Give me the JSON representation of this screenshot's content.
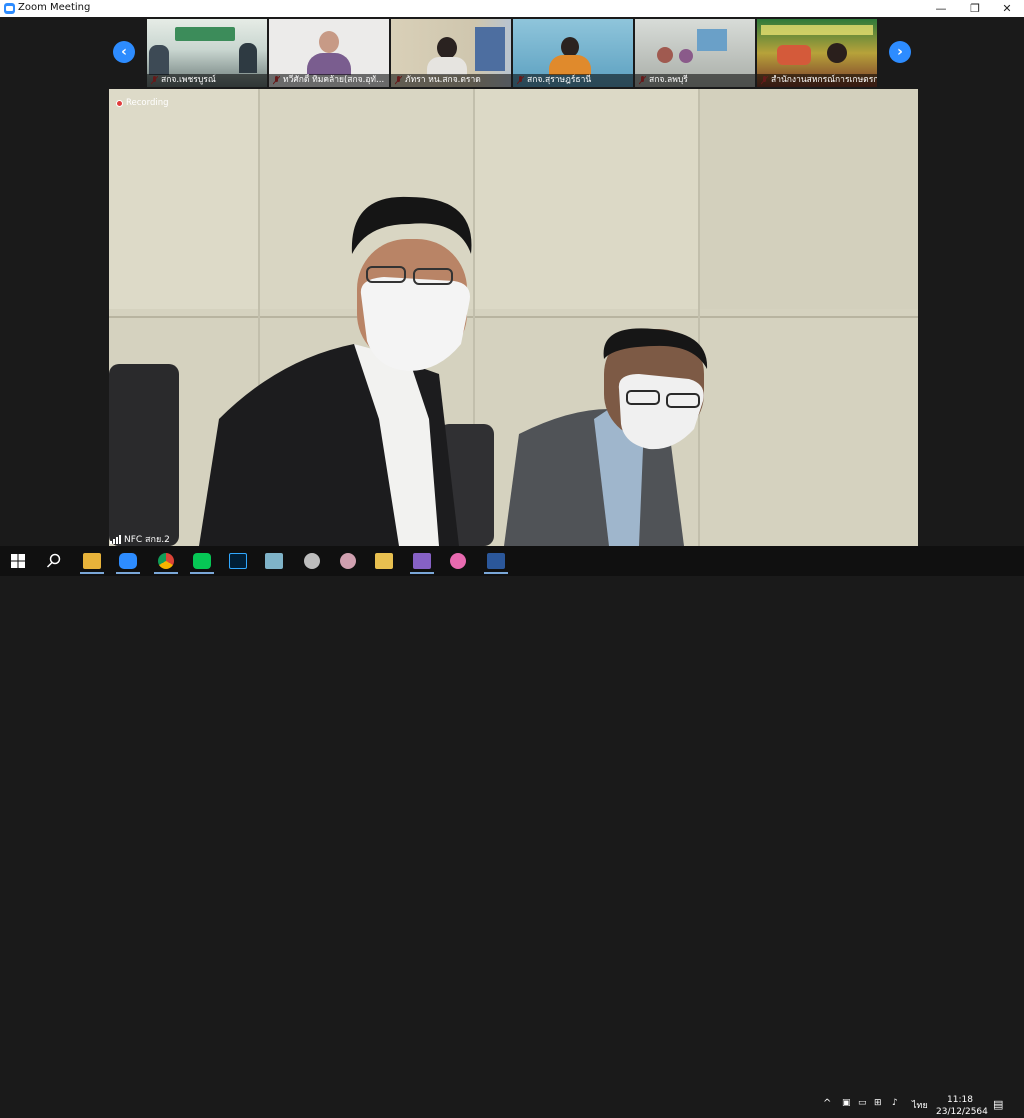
{
  "window": {
    "title": "Zoom Meeting",
    "minimize": "—",
    "maximize": "❐",
    "close": "✕"
  },
  "gallery": {
    "prev": "‹",
    "next": "›",
    "thumbnails": [
      {
        "name": "สกจ.เพชรบูรณ์",
        "bg": "#8fa7a0"
      },
      {
        "name": "ทวีศักดิ์ ทิมคล้าย(สกจ.อุทั...",
        "bg": "#e8e8e6"
      },
      {
        "name": "ภัทรา หน.สกจ.ตราด",
        "bg": "#cfc9b8"
      },
      {
        "name": "สกจ.สุราษฎร์ธานี",
        "bg": "#6fb0c9"
      },
      {
        "name": "สกจ.ลพบุรี",
        "bg": "#b9bcb6"
      },
      {
        "name": "สำนักงานสหกรณ์การเกษตรกร จั...",
        "bg": "#8c9a3c"
      }
    ]
  },
  "main_video": {
    "recording": "Recording",
    "participant": "NFC สกย.2"
  },
  "taskbar": {
    "apps": [
      {
        "name": "start",
        "color": "#ffffff"
      },
      {
        "name": "search",
        "color": "#ffffff"
      },
      {
        "name": "file-explorer",
        "color": "#e8b33a"
      },
      {
        "name": "zoom",
        "color": "#2d8cff"
      },
      {
        "name": "chrome",
        "color": "#db4437"
      },
      {
        "name": "line",
        "color": "#06c755"
      },
      {
        "name": "photoshop",
        "color": "#31a8ff"
      },
      {
        "name": "app-7",
        "color": "#7fb3c8"
      },
      {
        "name": "app-8",
        "color": "#bdbdbd"
      },
      {
        "name": "app-9",
        "color": "#d0a0b0"
      },
      {
        "name": "app-10",
        "color": "#e8c050"
      },
      {
        "name": "visual-studio",
        "color": "#8661c5"
      },
      {
        "name": "itunes",
        "color": "#e86ab0"
      },
      {
        "name": "word",
        "color": "#2b579a"
      }
    ],
    "tray": {
      "chevron": "^",
      "lang": "ไทย"
    },
    "clock": {
      "time": "11:18",
      "date": "23/12/2564"
    }
  }
}
